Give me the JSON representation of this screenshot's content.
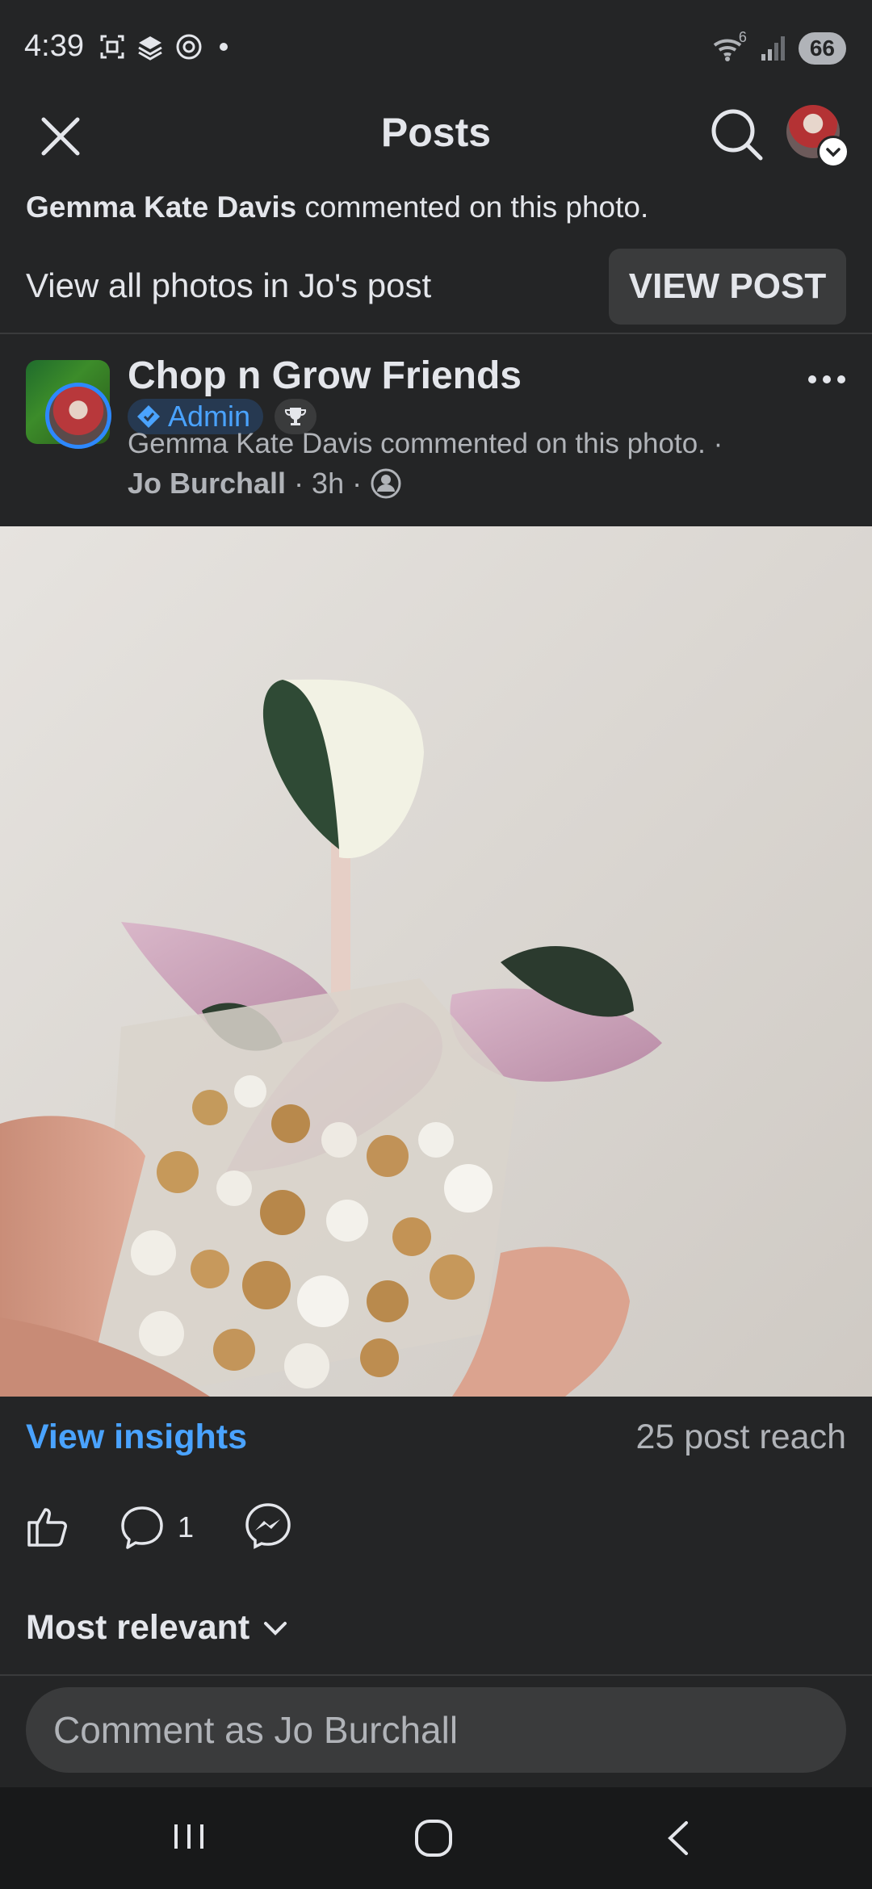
{
  "status_bar": {
    "time": "4:39",
    "wifi_badge": "6",
    "battery": "66"
  },
  "header": {
    "title": "Posts"
  },
  "notification": {
    "commenter": "Gemma Kate Davis",
    "text": " commented on this photo.",
    "view_all": "View all photos in Jo's post",
    "view_post_label": "VIEW POST"
  },
  "post": {
    "group_name": "Chop n Grow Friends",
    "badge": "Admin",
    "meta": "Gemma Kate Davis commented on this photo. ·",
    "author": "Jo Burchall",
    "time": "· 3h ·"
  },
  "insights": {
    "view_insights": "View insights",
    "reach": "25 post reach"
  },
  "actions": {
    "comment_count": "1"
  },
  "comments": {
    "sort_label": "Most relevant",
    "input_placeholder": "Comment as Jo Burchall"
  },
  "icons": {
    "close": "close-icon",
    "search": "search-icon",
    "more": "more-horizontal-icon",
    "like": "thumbs-up-icon",
    "comment": "comment-bubble-icon",
    "share": "messenger-icon"
  }
}
